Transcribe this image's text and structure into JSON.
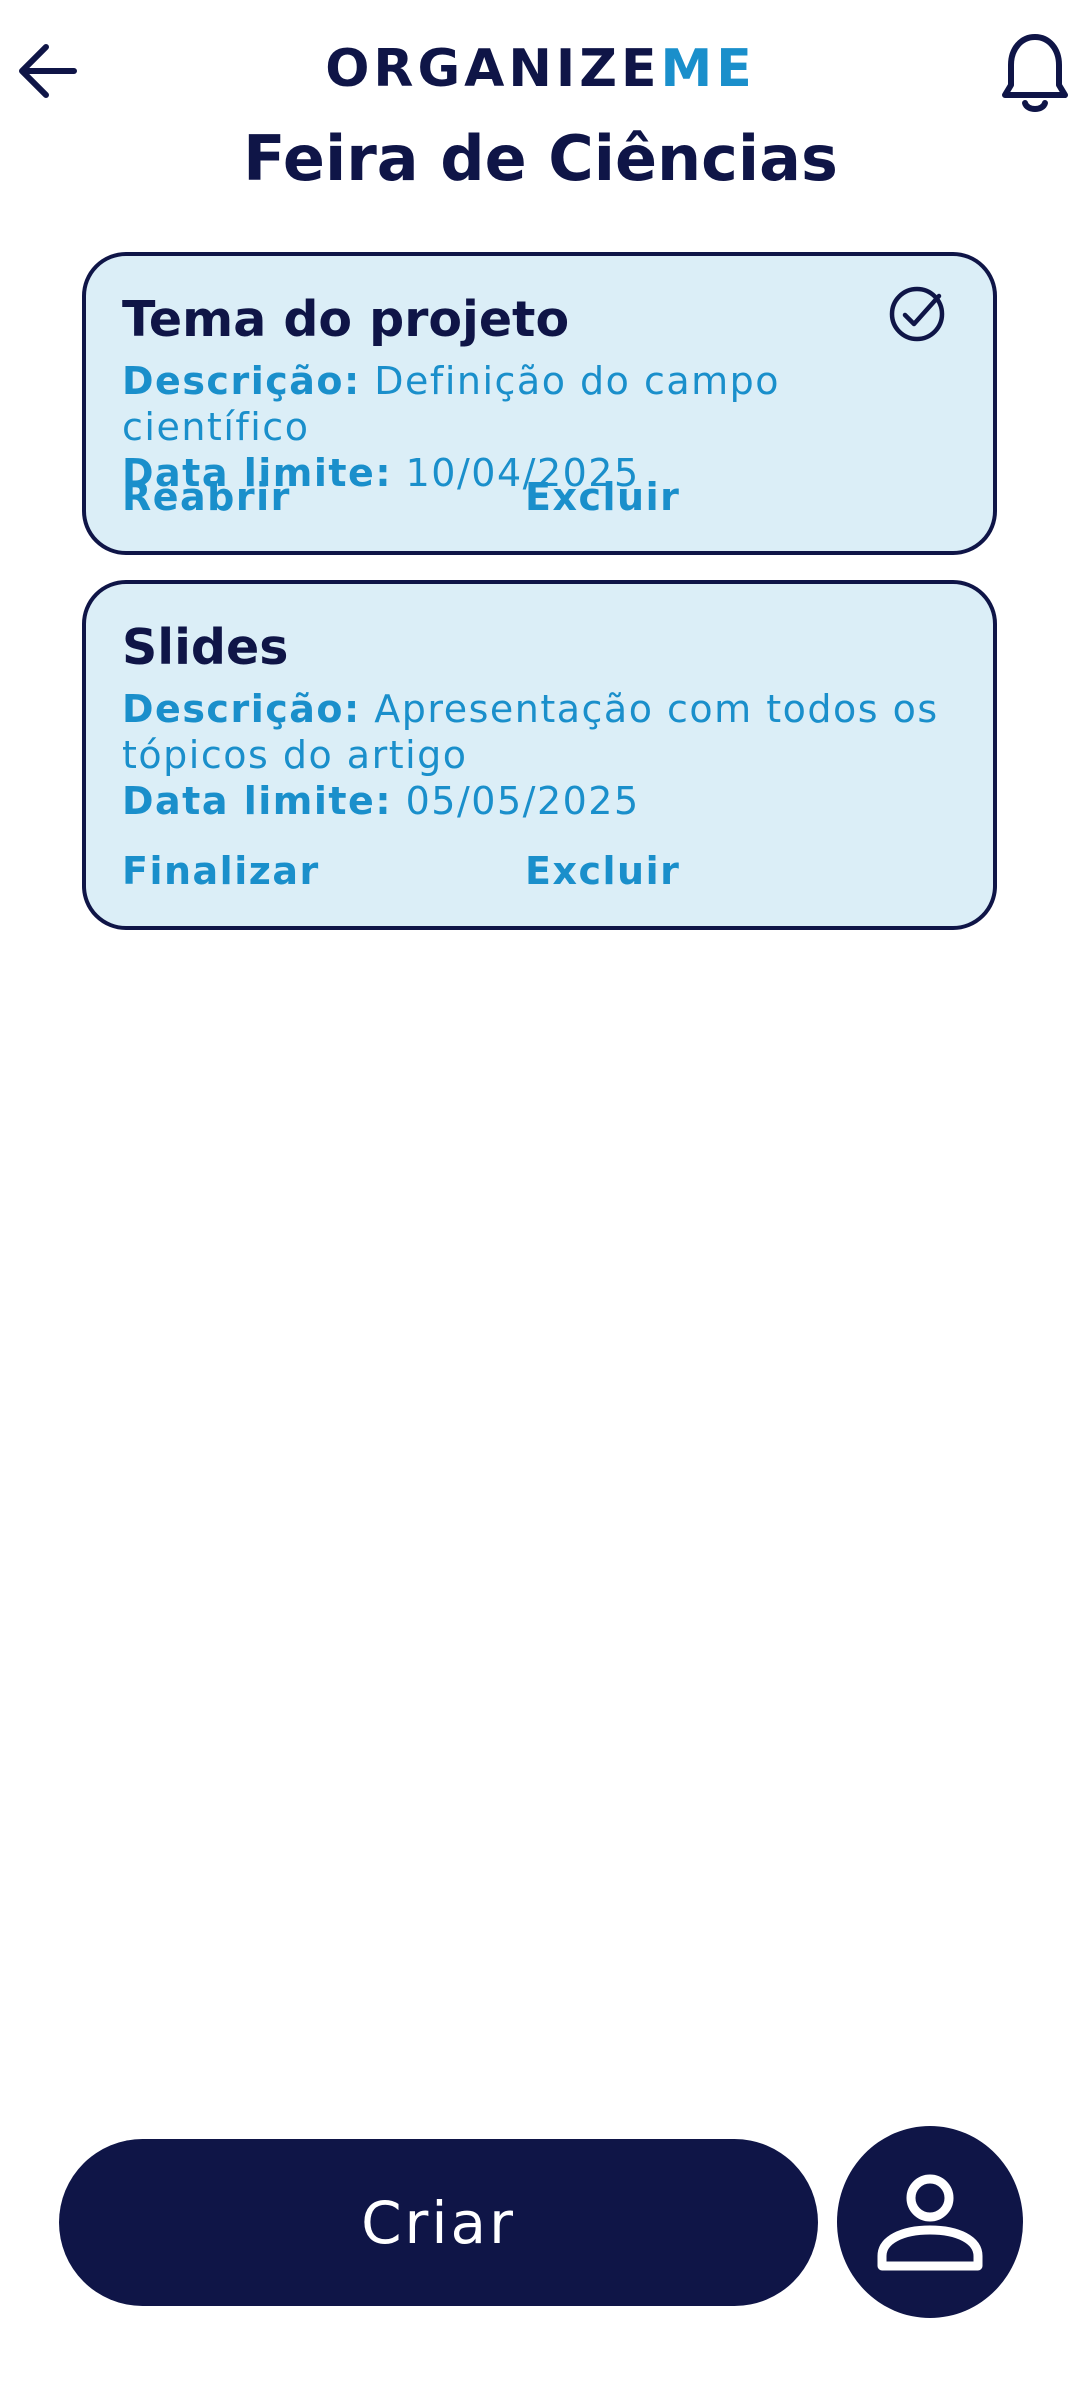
{
  "header": {
    "back_icon": "arrow-left-icon",
    "logo_part1": "ORGANIZE",
    "logo_part2": "ME",
    "notification_icon": "bell-icon",
    "page_title": "Feira de Ciências"
  },
  "tasks": [
    {
      "title": "Tema do projeto",
      "description_label": "Descrição:",
      "description": "Definição do campo científico",
      "deadline_label": "Data limite:",
      "deadline": "10/04/2025",
      "primary_action": "Reabrir",
      "delete_action": "Excluir",
      "completed": true,
      "status_icon": "check-circle-icon"
    },
    {
      "title": "Slides",
      "description_label": "Descrição:",
      "description": "Apresentação com todos os tópicos do artigo",
      "deadline_label": "Data limite:",
      "deadline": "05/05/2025",
      "primary_action": "Finalizar",
      "delete_action": "Excluir",
      "completed": false
    }
  ],
  "footer": {
    "create_label": "Criar",
    "profile_icon": "user-icon"
  },
  "colors": {
    "navy": "#0f1547",
    "accent": "#1a8fcb",
    "card_bg": "#dbeef7"
  }
}
